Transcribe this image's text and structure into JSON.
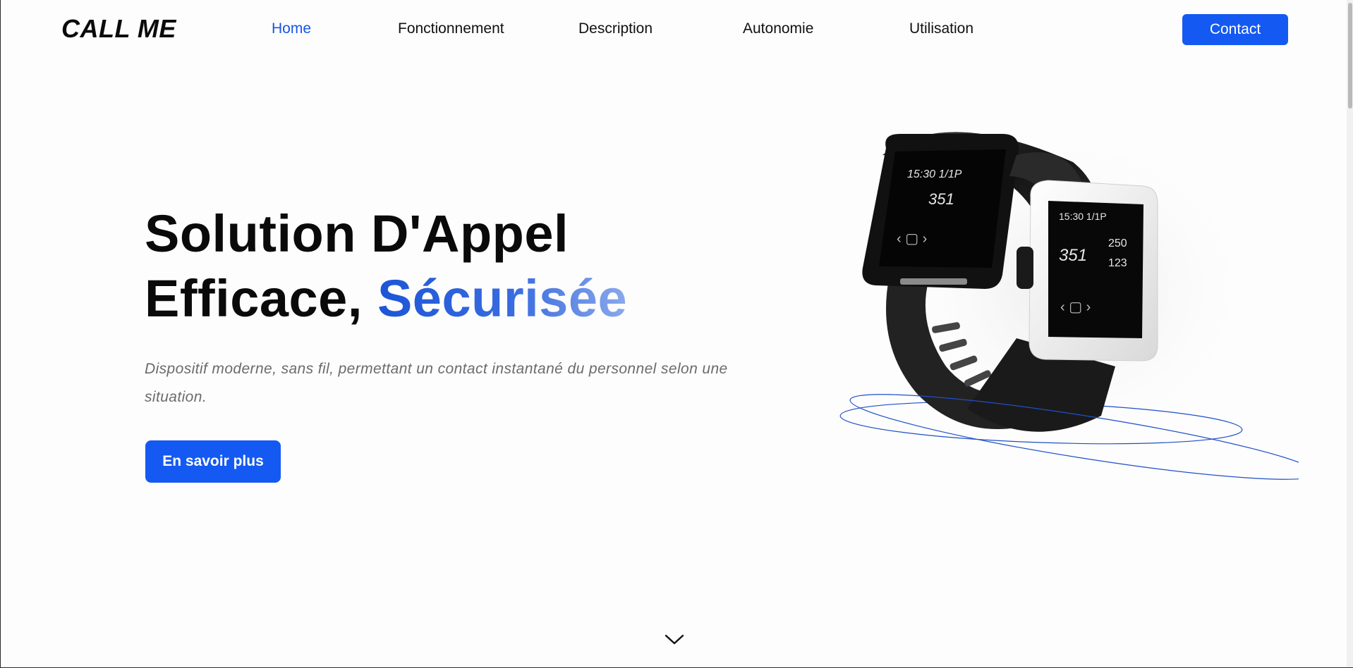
{
  "brand": {
    "logo_text": "CALL ME"
  },
  "nav": {
    "items": [
      {
        "label": "Home",
        "active": true
      },
      {
        "label": "Fonctionnement",
        "active": false
      },
      {
        "label": "Description",
        "active": false
      },
      {
        "label": "Autonomie",
        "active": false
      },
      {
        "label": "Utilisation",
        "active": false
      }
    ],
    "contact_label": "Contact"
  },
  "hero": {
    "title_line1": "Solution D'Appel",
    "title_line2_prefix": "Efficace, ",
    "title_line2_accent": "Sécurisée",
    "description": "Dispositif moderne, sans fil, permettant un contact instantané du personnel selon une situation.",
    "cta_label": "En savoir plus"
  },
  "product_image": {
    "icon": "smartwatch-pair-image",
    "black_watch_screen": {
      "status": "15:30 1/1P",
      "number": "351"
    },
    "white_watch_screen": {
      "status": "15:30 1/1P",
      "number": "351",
      "line1": "250",
      "line2": "123"
    }
  },
  "scroll_indicator": {
    "icon": "chevron-down-icon"
  },
  "colors": {
    "accent": "#145af2",
    "active_nav": "#1556e8",
    "text": "#0b0b0b",
    "muted_text": "#6b6b6b",
    "background": "#fdfdfd"
  }
}
